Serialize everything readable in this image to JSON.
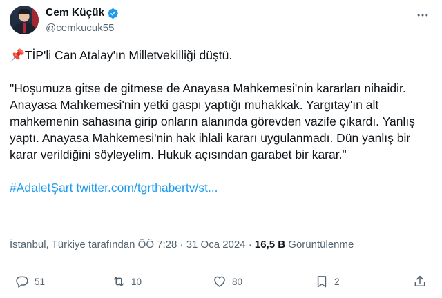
{
  "author": {
    "display_name": "Cem Küçük",
    "handle": "@cemkucuk55",
    "verified": true
  },
  "tweet": {
    "pin_emoji": "📌",
    "first_line": "TİP'li Can Atalay'ın Milletvekilliği düştü.",
    "quote": "\"Hoşumuza gitse de gitmese de Anayasa Mahkemesi'nin kararları nihaidir. Anayasa Mahkemesi'nin yetki gaspı yaptığı muhakkak. Yargıtay'ın alt mahkemenin sahasına girip onların alanında görevden vazife çıkardı. Yanlış yaptı. Anayasa Mahkemesi'nin hak ihlali kararı uygulanmadı. Dün yanlış bir karar verildiğini söyleyelim. Hukuk açısından garabet bir karar.\"",
    "hashtag": "#AdaletŞart",
    "link": "twitter.com/tgrthabertv/st..."
  },
  "meta": {
    "location_time": "İstanbul, Türkiye tarafından ÖÖ 7:28 · 31 Oca 2024 · ",
    "views_count": "16,5 B",
    "views_label": " Görüntülenme"
  },
  "actions": {
    "replies": "51",
    "retweets": "10",
    "likes": "80",
    "bookmarks": "2"
  },
  "colors": {
    "link": "#1d9bf0",
    "secondary": "#536471",
    "primary": "#0f1419",
    "verified": "#1d9bf0"
  }
}
